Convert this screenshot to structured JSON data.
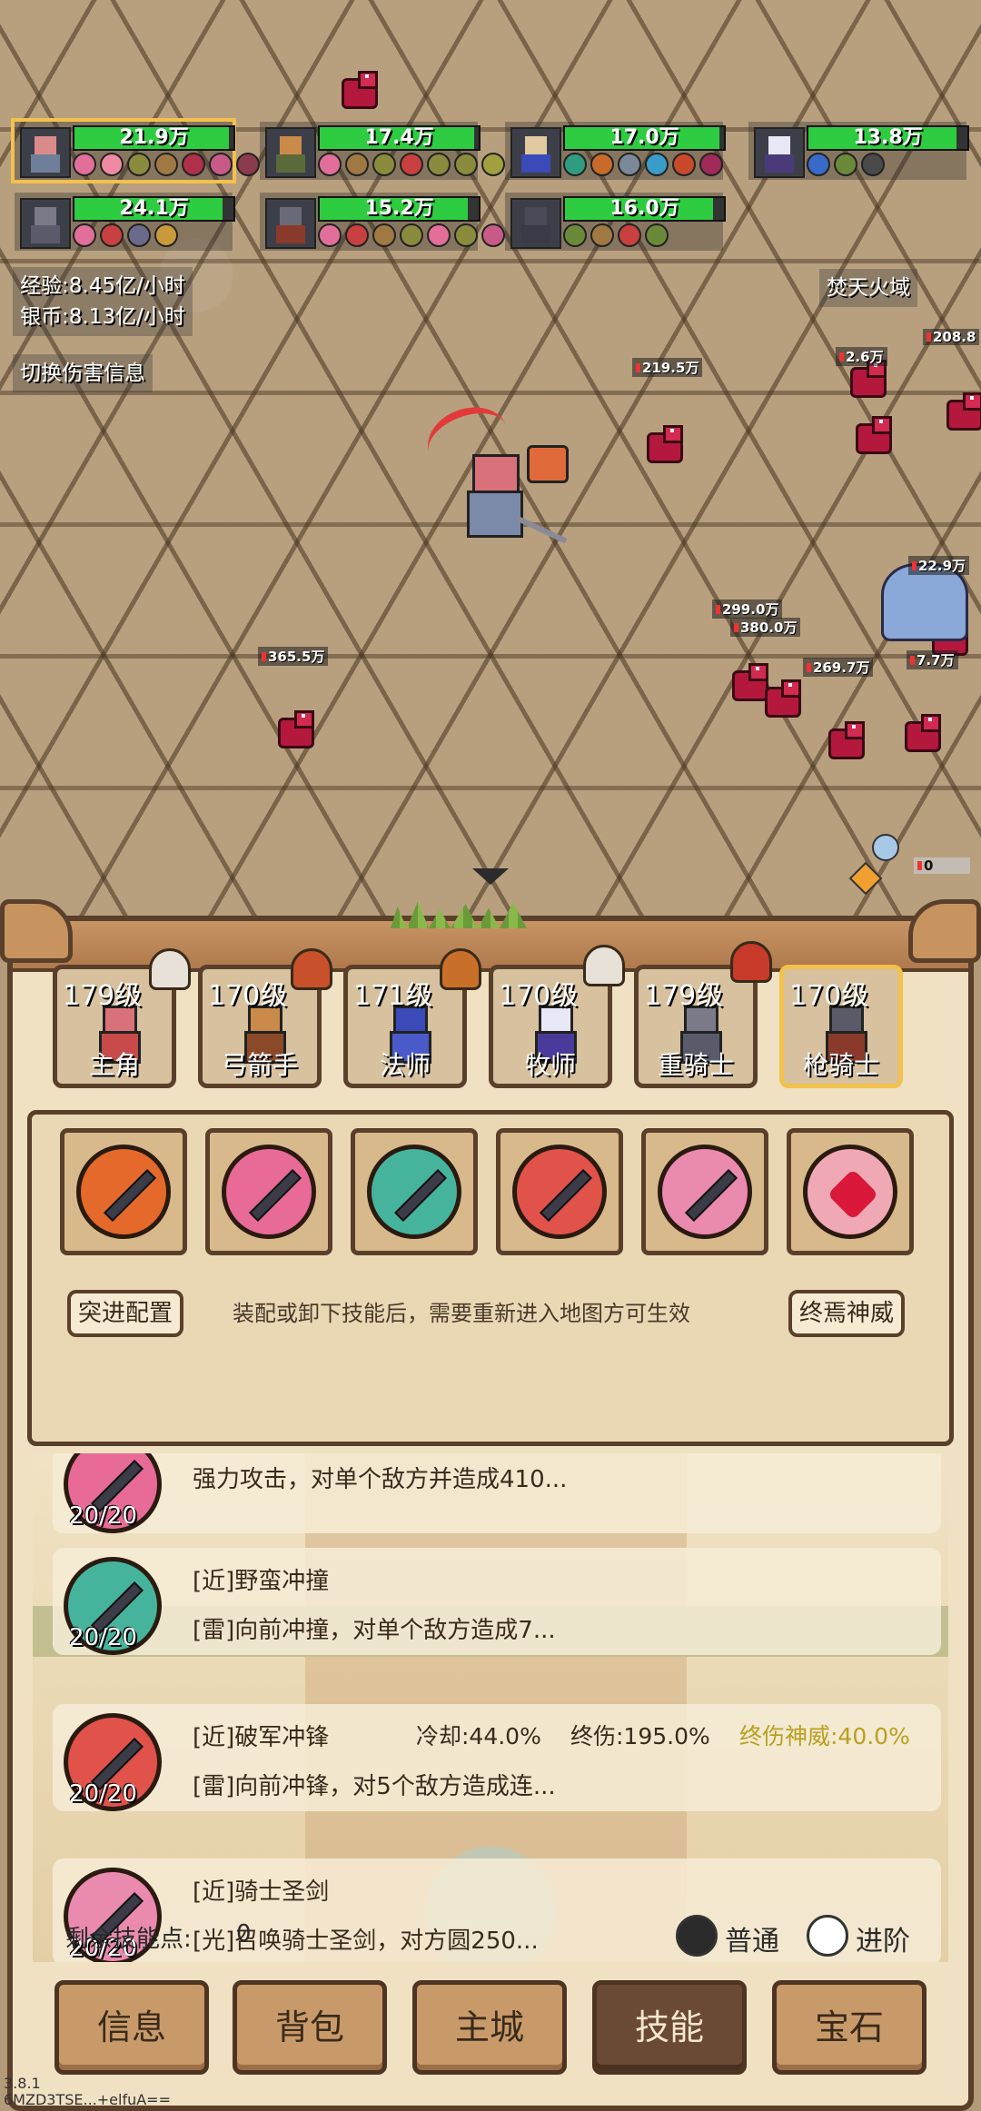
{
  "heroes": [
    {
      "hp": "21.9万",
      "fill": 0.97,
      "selected": true,
      "buffs": [
        "#e26f9a",
        "#f08aa3",
        "#8a8b3c",
        "#a07942",
        "#b0304a",
        "#c85a88",
        "#8a3b4e"
      ]
    },
    {
      "hp": "17.4万",
      "fill": 0.97,
      "selected": false,
      "buffs": [
        "#e26f9a",
        "#a07942",
        "#8a8b3c",
        "#c84040",
        "#8a8b3c",
        "#8a8b3c",
        "#a0a040"
      ]
    },
    {
      "hp": "17.0万",
      "fill": 0.97,
      "selected": false,
      "buffs": [
        "#2f9c80",
        "#c86a2a",
        "#7a8a9a",
        "#3a9cc8",
        "#c84a2a",
        "#a02a5a"
      ]
    },
    {
      "hp": "13.8万",
      "fill": 0.93,
      "selected": false,
      "buffs": [
        "#3a6ac8",
        "#6a8a3a",
        "#4a4a4a"
      ]
    },
    {
      "hp": "24.1万",
      "fill": 0.93,
      "selected": false,
      "buffs": [
        "#e26f9a",
        "#c84040",
        "#6a6a8a",
        "#c89a3a"
      ]
    },
    {
      "hp": "15.2万",
      "fill": 0.93,
      "selected": false,
      "buffs": [
        "#e26f9a",
        "#c84040",
        "#a07942",
        "#8a8b3c",
        "#e26f9a",
        "#8a8b3c",
        "#c85a88"
      ]
    },
    {
      "hp": "16.0万",
      "fill": 0.93,
      "selected": false,
      "buffs": [
        "#6a8a3a",
        "#a07942",
        "#c84040",
        "#6a8a3a"
      ]
    }
  ],
  "stats": {
    "exp": "经验:8.45亿/小时",
    "silver": "银币:8.13亿/小时"
  },
  "toggle_dmg": "切换伤害信息",
  "zone": "焚天火域",
  "damage_numbers": [
    "208.8",
    "219.5万",
    "2.6万",
    "22.9万",
    "299.0万",
    "380.0万",
    "269.7万",
    "7.7万",
    "365.5万",
    "0"
  ],
  "party": [
    {
      "level": "179级",
      "name": "主角"
    },
    {
      "level": "170级",
      "name": "弓箭手"
    },
    {
      "level": "171级",
      "name": "法师"
    },
    {
      "level": "170级",
      "name": "牧师"
    },
    {
      "level": "179级",
      "name": "重骑士"
    },
    {
      "level": "170级",
      "name": "枪骑士",
      "selected": true
    }
  ],
  "skill_slots": [
    {
      "color": "#e4692a",
      "icon": "blade"
    },
    {
      "color": "#e86a96",
      "icon": "blade"
    },
    {
      "color": "#46b49c",
      "icon": "blade"
    },
    {
      "color": "#e0524a",
      "icon": "blade"
    },
    {
      "color": "#e98aae",
      "icon": "blade"
    },
    {
      "color": "#f0a8b4",
      "icon": "heart"
    }
  ],
  "config_left": "突进配置",
  "config_right": "终焉神威",
  "config_hint": "装配或卸下技能后，需要重新进入地图方可生效",
  "skills": [
    {
      "color": "#e86a96",
      "count": "20/20",
      "title": "",
      "desc": "强力攻击，对单个敌方并造成410..."
    },
    {
      "color": "#46b49c",
      "count": "20/20",
      "title": "[近]野蛮冲撞",
      "desc": "[雷]向前冲撞，对单个敌方造成7..."
    },
    {
      "color": "#e0524a",
      "count": "20/20",
      "title": "[近]破军冲锋",
      "cooldown": "冷却:44.0%",
      "final_dmg": "终伤:195.0%",
      "final_bonus": "终伤神威:40.0%",
      "desc": "[雷]向前冲锋，对5个敌方造成连..."
    },
    {
      "color": "#e98aae",
      "count": "20/20",
      "title": "[近]骑士圣剑",
      "desc": "[光]召唤骑士圣剑，对方圆250..."
    }
  ],
  "points_label": "剩余技能点:",
  "points_value": "0",
  "mode_normal": "普通",
  "mode_adv": "进阶",
  "nav": [
    {
      "label": "信息"
    },
    {
      "label": "背包"
    },
    {
      "label": "主城"
    },
    {
      "label": "技能",
      "selected": true
    },
    {
      "label": "宝石"
    }
  ],
  "version": "3.8.1",
  "build": "6MZD3TSE...+elfuA=="
}
